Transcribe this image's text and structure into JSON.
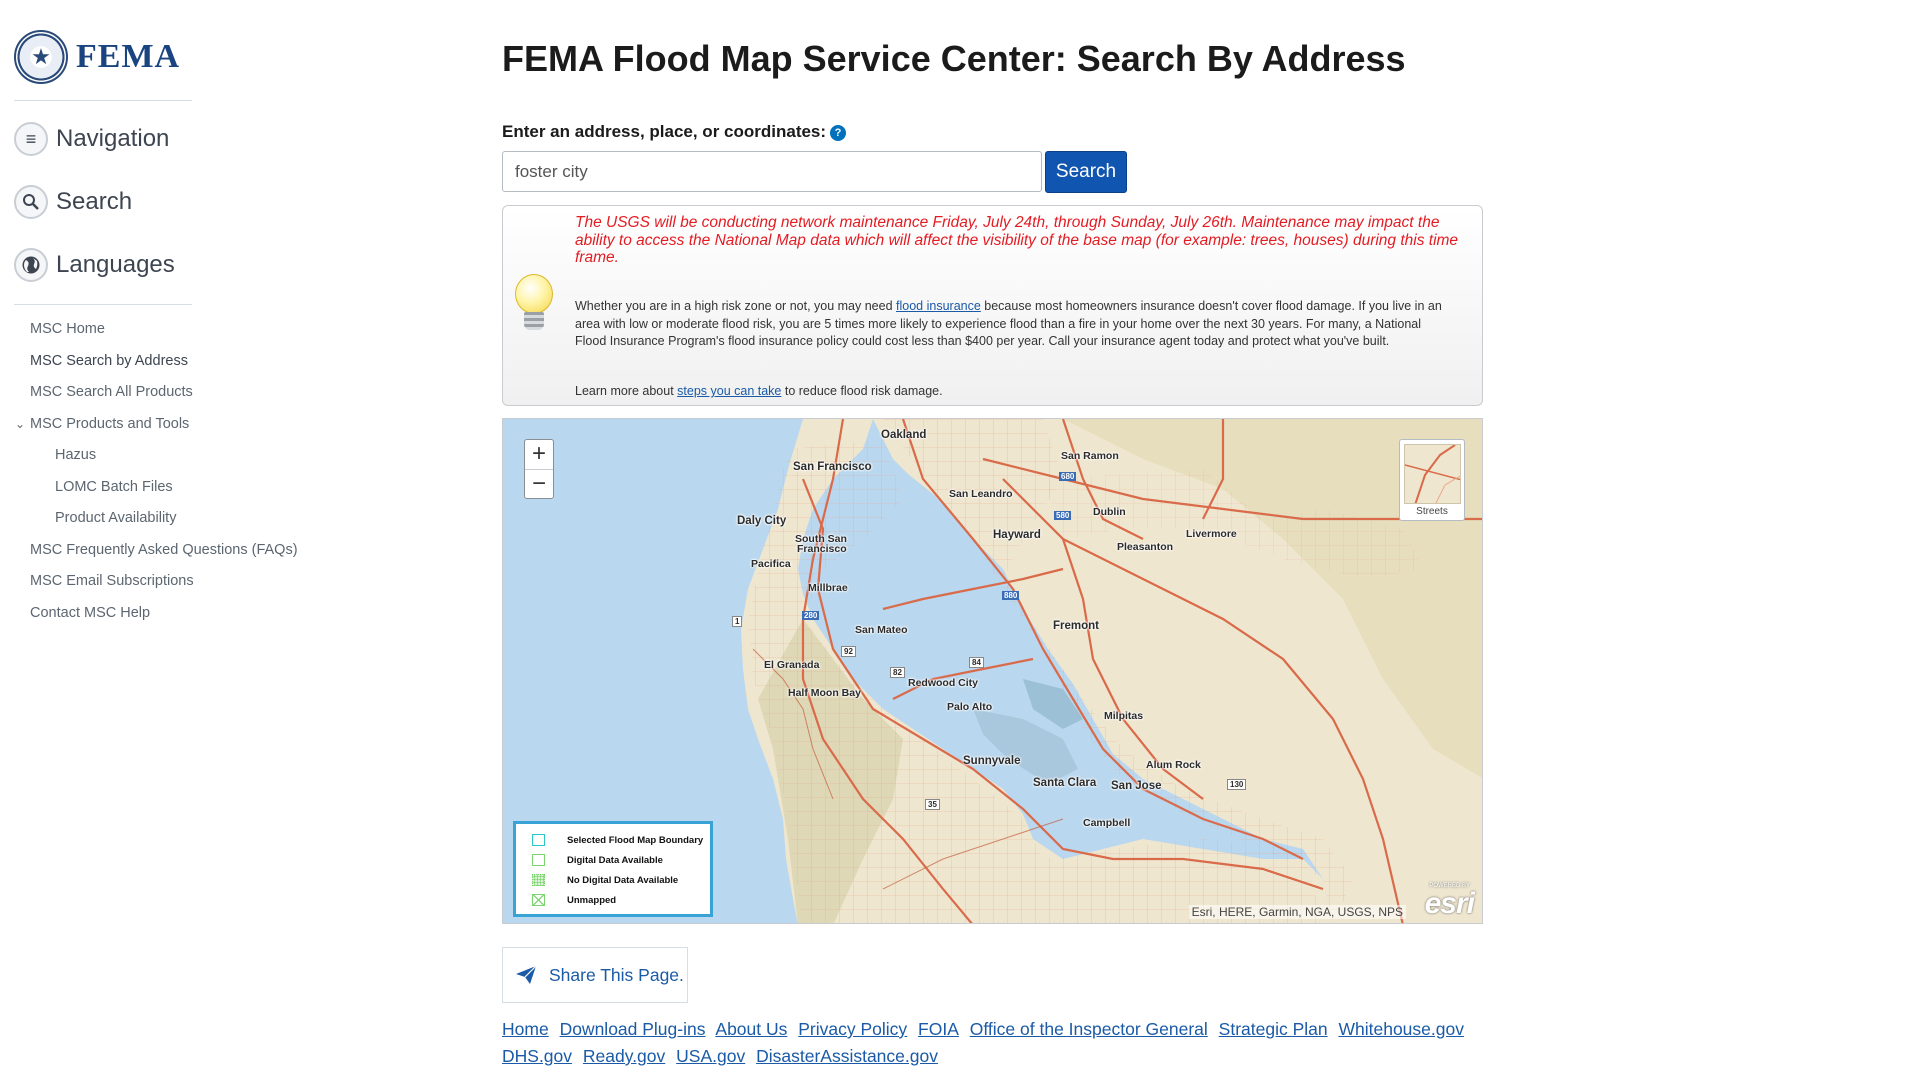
{
  "logo": {
    "text": "FEMA",
    "seal_text": "DEPARTMENT OF HOMELAND SECURITY"
  },
  "sidebar": {
    "sections": [
      {
        "label": "Navigation",
        "icon": "list-icon"
      },
      {
        "label": "Search",
        "icon": "search-icon"
      },
      {
        "label": "Languages",
        "icon": "globe-icon"
      }
    ],
    "links": [
      {
        "label": "MSC Home"
      },
      {
        "label": "MSC Search by Address"
      },
      {
        "label": "MSC Search All Products"
      },
      {
        "label": "MSC Products and Tools"
      },
      {
        "label": "Hazus"
      },
      {
        "label": "LOMC Batch Files"
      },
      {
        "label": "Product Availability"
      },
      {
        "label": "MSC Frequently Asked Questions (FAQs)"
      },
      {
        "label": "MSC Email Subscriptions"
      },
      {
        "label": "Contact MSC Help"
      }
    ]
  },
  "main": {
    "title": "FEMA Flood Map Service Center: Search By Address",
    "address_label": "Enter an address, place, or coordinates:",
    "help_icon": "question-icon",
    "search_value": "foster city",
    "search_button": "Search"
  },
  "notice": {
    "icon": "lightbulb-icon",
    "warning": "The USGS will be conducting network maintenance Friday, July 24th, through Sunday, July 26th. Maintenance may impact the ability to access the National Map data which will affect the visibility of the base map (for example: trees, houses) during this time frame.",
    "info_before": "Whether you are in a high risk zone or not, you may need ",
    "info_link": "flood insurance",
    "info_after": " because most homeowners insurance doesn't cover flood damage. If you live in an area with low or moderate flood risk, you are 5 times more likely to experience flood than a fire in your home over the next 30 years. For many, a National Flood Insurance Program's flood insurance policy could cost less than $400 per year. Call your insurance agent today and protect what you've built.",
    "more_before": "Learn more about ",
    "more_link": "steps you can take",
    "more_after": " to reduce flood risk damage."
  },
  "map": {
    "zoom_in": "+",
    "zoom_out": "−",
    "basemap_label": "Streets",
    "places": {
      "oakland": "Oakland",
      "san_francisco": "San Francisco",
      "san_ramon": "San Ramon",
      "san_leandro": "San Leandro",
      "daly_city": "Daly City",
      "dublin": "Dublin",
      "hayward": "Hayward",
      "livermore": "Livermore",
      "pleasanton": "Pleasanton",
      "south_sf_1": "South San",
      "south_sf_2": "Francisco",
      "pacifica": "Pacifica",
      "millbrae": "Millbrae",
      "fremont": "Fremont",
      "san_mateo": "San Mateo",
      "el_granada": "El Granada",
      "redwood_city": "Redwood City",
      "half_moon_bay": "Half Moon Bay",
      "palo_alto": "Palo Alto",
      "milpitas": "Milpitas",
      "sunnyvale": "Sunnyvale",
      "alum_rock": "Alum Rock",
      "santa_clara": "Santa Clara",
      "san_jose": "San Jose",
      "campbell": "Campbell"
    },
    "shields": {
      "i680a": "680",
      "i580": "580",
      "i880": "880",
      "i280": "280",
      "r1": "1",
      "r92": "92",
      "r84": "84",
      "r82": "82",
      "r35": "35",
      "r130": "130"
    },
    "legend": [
      {
        "label": "Selected Flood Map Boundary",
        "kind": "selected"
      },
      {
        "label": "Digital Data Available",
        "kind": "digital"
      },
      {
        "label": "No Digital Data Available",
        "kind": "nodigital"
      },
      {
        "label": "Unmapped",
        "kind": "unmapped"
      }
    ],
    "attribution": "Esri, HERE, Garmin, NGA, USGS, NPS",
    "esri_powered": "POWERED BY",
    "esri_logo": "esri"
  },
  "share": {
    "label": "Share This Page.",
    "icon": "paper-plane-icon"
  },
  "footer": {
    "links": [
      "Home",
      "Download Plug-ins",
      "About Us",
      "Privacy Policy",
      "FOIA",
      "Office of the Inspector General",
      "Strategic Plan",
      "Whitehouse.gov",
      "DHS.gov",
      "Ready.gov",
      "USA.gov",
      "DisasterAssistance.gov"
    ]
  }
}
